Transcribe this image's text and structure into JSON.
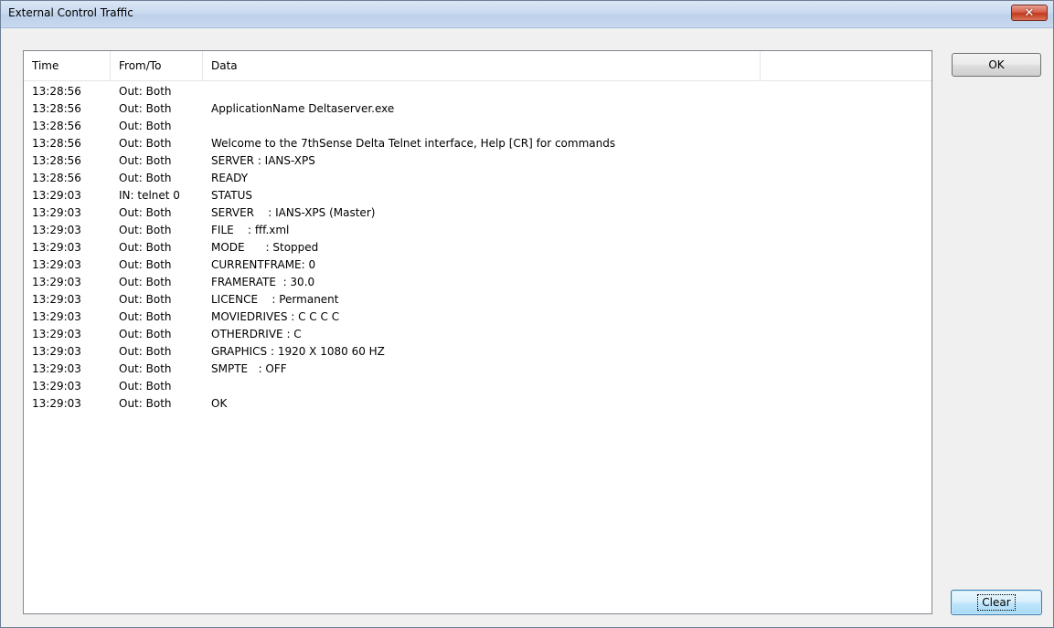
{
  "window": {
    "title": "External Control Traffic",
    "close_glyph": "✕"
  },
  "listview": {
    "columns": [
      "Time",
      "From/To",
      "Data",
      ""
    ],
    "rows": [
      {
        "time": "13:28:56",
        "from_to": "Out: Both",
        "data": ""
      },
      {
        "time": "13:28:56",
        "from_to": "Out: Both",
        "data": "ApplicationName Deltaserver.exe"
      },
      {
        "time": "13:28:56",
        "from_to": "Out: Both",
        "data": ""
      },
      {
        "time": "13:28:56",
        "from_to": "Out: Both",
        "data": "Welcome to the 7thSense Delta Telnet interface, Help [CR] for commands"
      },
      {
        "time": "13:28:56",
        "from_to": "Out: Both",
        "data": "SERVER : IANS-XPS"
      },
      {
        "time": "13:28:56",
        "from_to": "Out: Both",
        "data": "READY"
      },
      {
        "time": "13:29:03",
        "from_to": "IN: telnet 0",
        "data": "STATUS"
      },
      {
        "time": "13:29:03",
        "from_to": "Out: Both",
        "data": "SERVER    : IANS-XPS (Master)"
      },
      {
        "time": "13:29:03",
        "from_to": "Out: Both",
        "data": "FILE    : fff.xml"
      },
      {
        "time": "13:29:03",
        "from_to": "Out: Both",
        "data": "MODE      : Stopped"
      },
      {
        "time": "13:29:03",
        "from_to": "Out: Both",
        "data": "CURRENTFRAME: 0"
      },
      {
        "time": "13:29:03",
        "from_to": "Out: Both",
        "data": "FRAMERATE  : 30.0"
      },
      {
        "time": "13:29:03",
        "from_to": "Out: Both",
        "data": "LICENCE    : Permanent"
      },
      {
        "time": "13:29:03",
        "from_to": "Out: Both",
        "data": "MOVIEDRIVES : C C C C"
      },
      {
        "time": "13:29:03",
        "from_to": "Out: Both",
        "data": "OTHERDRIVE : C"
      },
      {
        "time": "13:29:03",
        "from_to": "Out: Both",
        "data": "GRAPHICS : 1920 X 1080 60 HZ"
      },
      {
        "time": "13:29:03",
        "from_to": "Out: Both",
        "data": "SMPTE   : OFF"
      },
      {
        "time": "13:29:03",
        "from_to": "Out: Both",
        "data": ""
      },
      {
        "time": "13:29:03",
        "from_to": "Out: Both",
        "data": "OK"
      }
    ]
  },
  "buttons": {
    "ok_label": "OK",
    "clear_label": "Clear"
  },
  "colors": {
    "close_button": "#c2391f",
    "titlebar": "#c9daf0",
    "dialog_background": "#f0f0f0"
  },
  "icons": {
    "close": "close-icon"
  }
}
